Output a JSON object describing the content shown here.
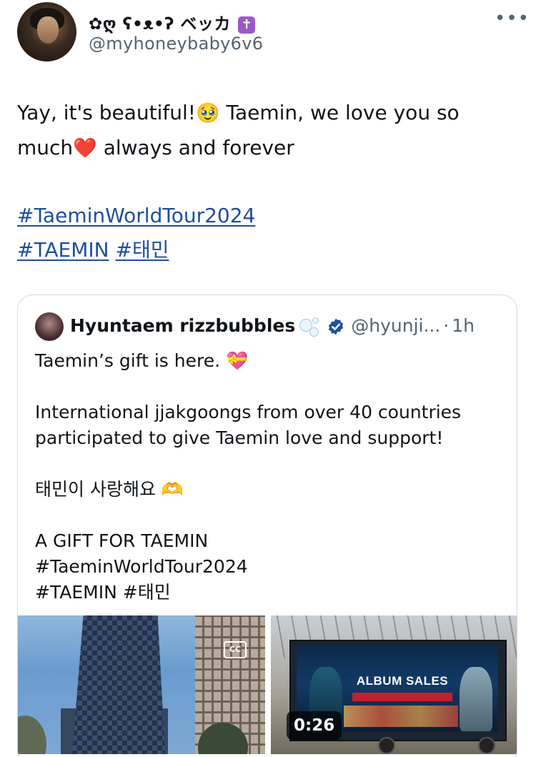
{
  "author": {
    "display_name": "✿ღ ʕ•ᴥ•ʔ ベッカ",
    "display_name_badge": "✝",
    "handle": "@myhoneybaby6v6",
    "more_icon": "more-horizontal-icon"
  },
  "tweet": {
    "line1_a": "Yay, it's beautiful!",
    "line1_emoji": "🥹",
    "line1_b": " Taemin, we love you so",
    "line2_a": "much",
    "line2_emoji": "❤️",
    "line2_b": " always and forever",
    "hashtags": [
      "#TaeminWorldTour2024",
      "#TAEMIN",
      "#태민"
    ]
  },
  "quoted": {
    "name": "Hyuntaem rizzbubbles",
    "name_icon": "bubbles-icon",
    "verified_icon": "verified-badge-icon",
    "handle": "@hyunji...",
    "separator": "·",
    "time": "1h",
    "text_rows": [
      "Taemin’s gift is here. 💝",
      "",
      "International jjakgoongs from over 40 countries",
      "participated to give Taemin love and support!",
      "",
      "태민이 사랑해요 🫶",
      "",
      "A GIFT FOR TAEMIN",
      "#TaeminWorldTour2024",
      "#TAEMIN #태민"
    ],
    "media": {
      "left_icon": "cc-icon",
      "left_icon_text": "CC",
      "right_overlay_title": "ALBUM SALES",
      "video_duration": "0:26"
    }
  },
  "colors": {
    "link": "#1d4f9c",
    "secondary_text": "#536471",
    "verified": "#1d4f9c",
    "heart": "#e0245e",
    "border": "#cfd9de"
  }
}
